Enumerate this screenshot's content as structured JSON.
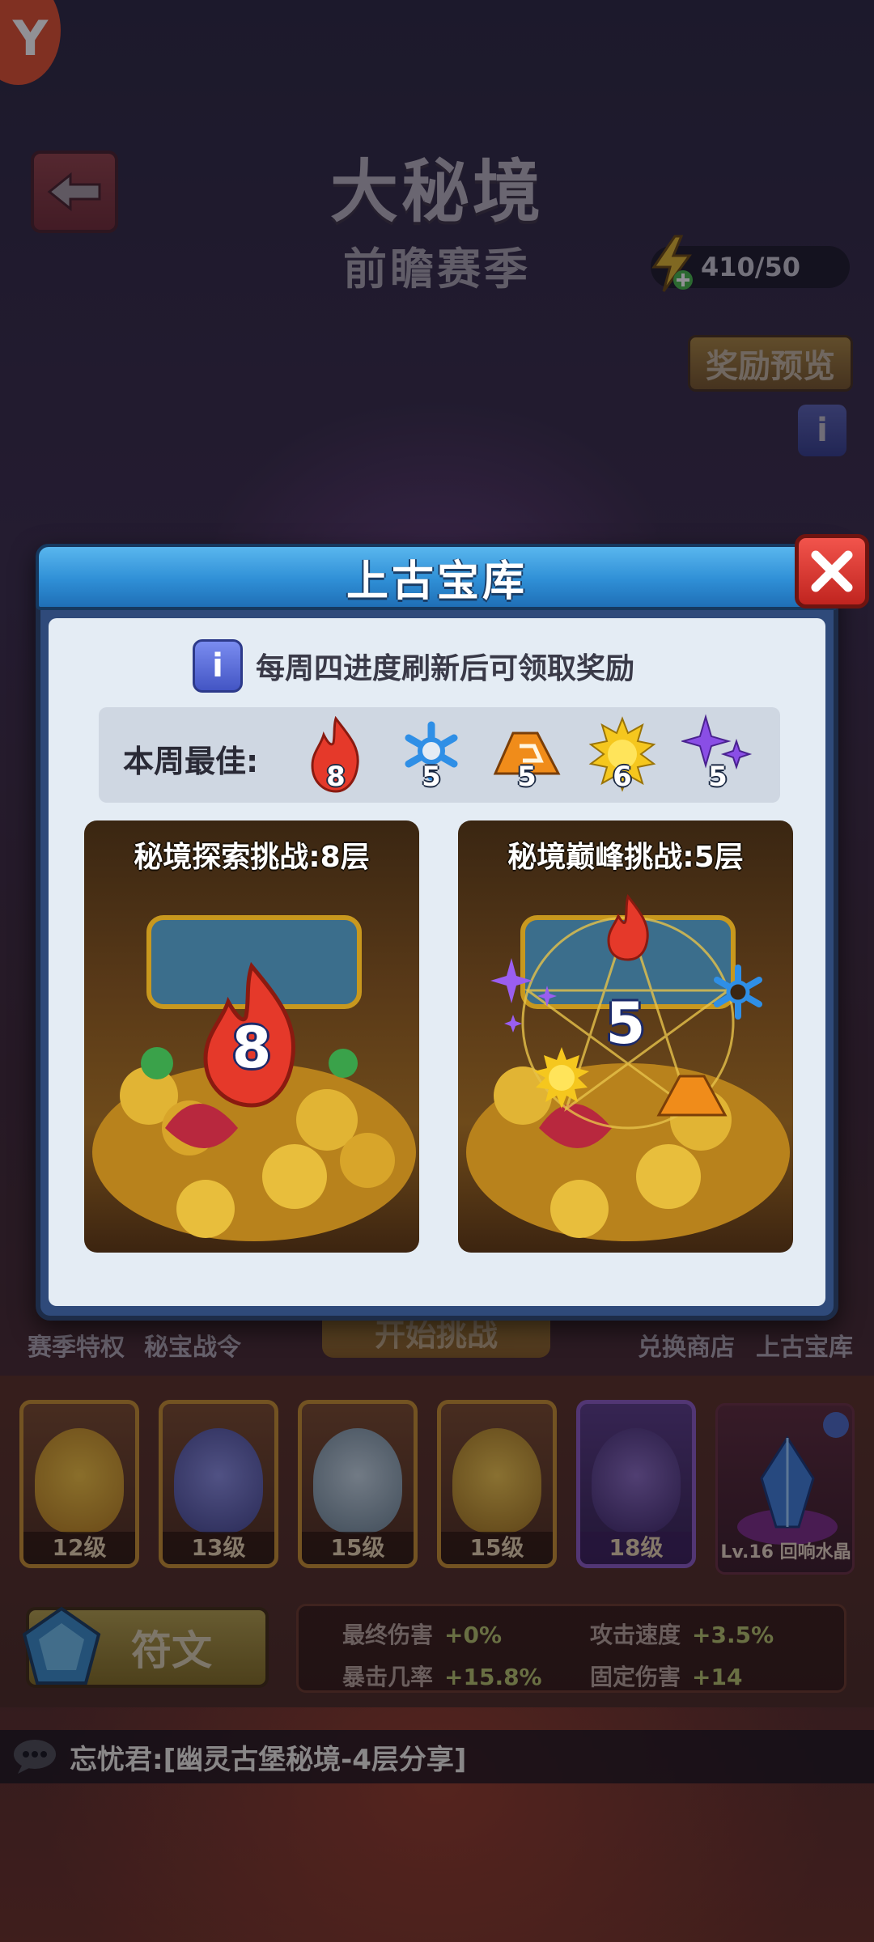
{
  "screen": {
    "title": "大秘境",
    "subtitle": "前瞻赛季",
    "brand_letter": "Y",
    "energy": "410/50",
    "reward_preview": "奖励预览",
    "info_glyph": "i"
  },
  "behind": {
    "season_privilege": "赛季特权",
    "treasure_pass": "秘宝战令",
    "start_challenge": "开始挑战",
    "exchange_shop": "兑换商店",
    "ancient_vault": "上古宝库"
  },
  "heroes": [
    {
      "level": "12级",
      "color": "#e2a42c"
    },
    {
      "level": "13级",
      "color": "#6b6fc0"
    },
    {
      "level": "15级",
      "color": "#9fb6c4"
    },
    {
      "level": "15级",
      "color": "#e7b23a"
    },
    {
      "level": "18级",
      "color": "#6a4c92"
    }
  ],
  "crystal": {
    "label": "Lv.16 回响水晶"
  },
  "rune": {
    "label": "符文"
  },
  "stats": [
    {
      "key": "最终伤害",
      "value": "+0%"
    },
    {
      "key": "攻击速度",
      "value": "+3.5%"
    },
    {
      "key": "暴击几率",
      "value": "+15.8%"
    },
    {
      "key": "固定伤害",
      "value": "+14"
    }
  ],
  "chat": {
    "message": "忘忧君:[幽灵古堡秘境-4层分享]"
  },
  "modal": {
    "title": "上古宝库",
    "notice": "每周四进度刷新后可领取奖励",
    "info_glyph": "i",
    "best_label": "本周最佳:",
    "best": [
      {
        "icon": "fire-icon",
        "value": "8",
        "color": "#e5392a"
      },
      {
        "icon": "snowflake-icon",
        "value": "5",
        "color": "#2f8fe6"
      },
      {
        "icon": "earth-icon",
        "value": "5",
        "color": "#f08c1a"
      },
      {
        "icon": "sun-icon",
        "value": "6",
        "color": "#f5c71e"
      },
      {
        "icon": "sparkle-icon",
        "value": "5",
        "color": "#8a4ee6"
      }
    ],
    "cards": [
      {
        "title": "秘境探索挑战:8层",
        "number": "8"
      },
      {
        "title": "秘境巅峰挑战:5层",
        "number": "5"
      }
    ]
  }
}
